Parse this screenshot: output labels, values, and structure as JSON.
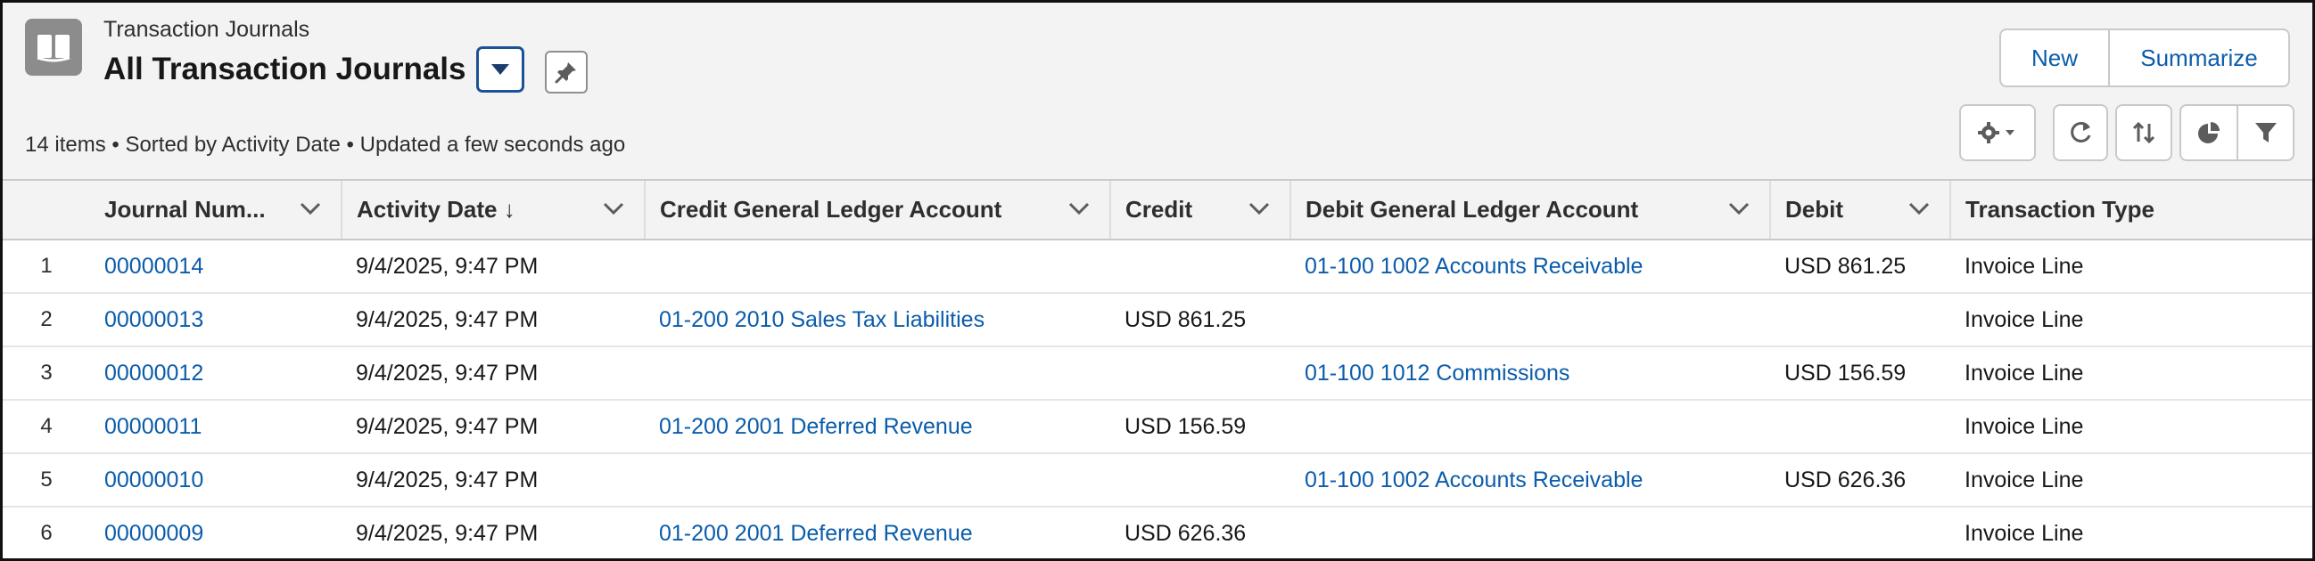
{
  "header": {
    "object_label": "Transaction Journals",
    "view_title": "All Transaction Journals",
    "meta": "14 items • Sorted by Activity Date • Updated a few seconds ago"
  },
  "actions": {
    "new_label": "New",
    "summarize_label": "Summarize"
  },
  "icons": {
    "app": "journal-book-icon",
    "view_switch": "triangle-down-icon",
    "pin": "pin-icon",
    "settings": "gear-icon",
    "refresh": "refresh-icon",
    "sort": "sort-arrows-icon",
    "chart": "pie-chart-icon",
    "filter": "funnel-icon"
  },
  "colors": {
    "link": "#0b5cab",
    "focus_border": "#1b5297",
    "header_bg": "#f3f3f3",
    "app_icon_bg": "#8c8c8c"
  },
  "table": {
    "columns": [
      "Journal Num...",
      "Activity Date ↓",
      "Credit General Ledger Account",
      "Credit",
      "Debit General Ledger Account",
      "Debit",
      "Transaction Type"
    ],
    "rows": [
      {
        "num": "1",
        "journal": "00000014",
        "date": "9/4/2025, 9:47 PM",
        "credit_account": "",
        "credit": "",
        "debit_account": "01-100 1002 Accounts Receivable",
        "debit": "USD 861.25",
        "type": "Invoice Line"
      },
      {
        "num": "2",
        "journal": "00000013",
        "date": "9/4/2025, 9:47 PM",
        "credit_account": "01-200 2010 Sales Tax Liabilities",
        "credit": "USD 861.25",
        "debit_account": "",
        "debit": "",
        "type": "Invoice Line"
      },
      {
        "num": "3",
        "journal": "00000012",
        "date": "9/4/2025, 9:47 PM",
        "credit_account": "",
        "credit": "",
        "debit_account": "01-100 1012 Commissions",
        "debit": "USD 156.59",
        "type": "Invoice Line"
      },
      {
        "num": "4",
        "journal": "00000011",
        "date": "9/4/2025, 9:47 PM",
        "credit_account": "01-200 2001 Deferred Revenue",
        "credit": "USD 156.59",
        "debit_account": "",
        "debit": "",
        "type": "Invoice Line"
      },
      {
        "num": "5",
        "journal": "00000010",
        "date": "9/4/2025, 9:47 PM",
        "credit_account": "",
        "credit": "",
        "debit_account": "01-100 1002 Accounts Receivable",
        "debit": "USD 626.36",
        "type": "Invoice Line"
      },
      {
        "num": "6",
        "journal": "00000009",
        "date": "9/4/2025, 9:47 PM",
        "credit_account": "01-200 2001 Deferred Revenue",
        "credit": "USD 626.36",
        "debit_account": "",
        "debit": "",
        "type": "Invoice Line"
      }
    ]
  }
}
